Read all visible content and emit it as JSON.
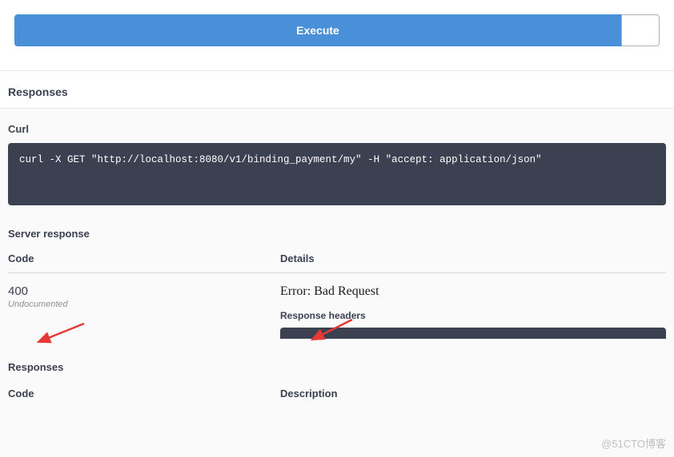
{
  "toolbar": {
    "execute_label": "Execute"
  },
  "responses_header": "Responses",
  "curl": {
    "label": "Curl",
    "command": "curl -X GET \"http://localhost:8080/v1/binding_payment/my\" -H \"accept: application/json\""
  },
  "server_response": {
    "label": "Server response",
    "code_header": "Code",
    "details_header": "Details",
    "code_value": "400",
    "undocumented": "Undocumented",
    "error_text": "Error: Bad Request",
    "response_headers_label": "Response headers"
  },
  "responses2": {
    "label": "Responses",
    "code_header": "Code",
    "description_header": "Description"
  },
  "watermark": "@51CTO博客"
}
